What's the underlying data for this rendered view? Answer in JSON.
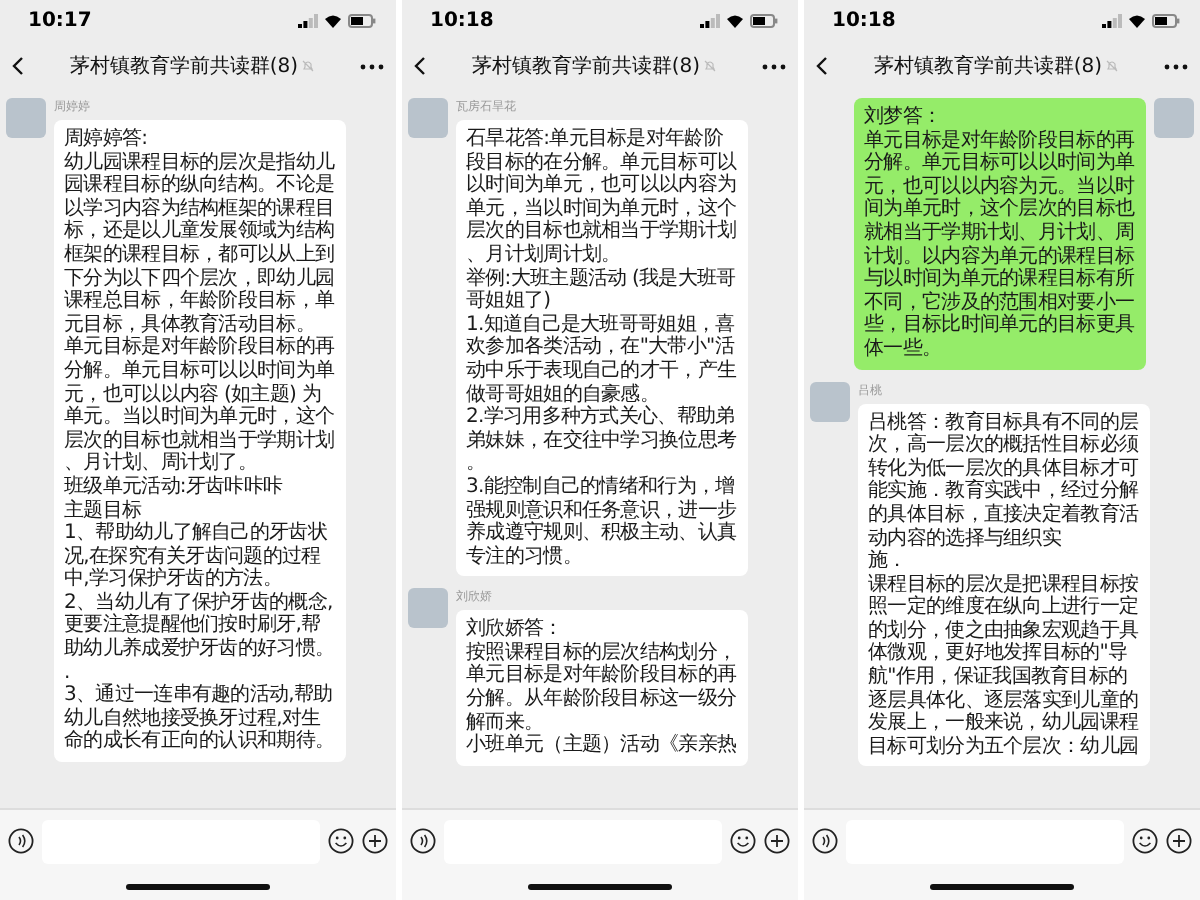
{
  "phones": [
    {
      "time": "10:17",
      "title": "茅村镇教育学前共读群(8)",
      "messages": [
        {
          "kind": "received",
          "sender": "周婷婷",
          "paragraphs": [
            "周婷婷答:",
            "幼儿园课程目标的层次是指幼儿园课程目标的纵向结构。不论是以学习内容为结构框架的课程目标，还是以儿童发展领域为结构框架的课程目标，都可以从上到下分为以下四个层次，即幼儿园课程总目标，年龄阶段目标，单元目标，具体教育活动目标。",
            "单元目标是对年龄阶段目标的再分解。单元目标可以以时间为单元，也可以以内容 (如主题) 为单元。当以时间为单元时，这个层次的目标也就相当于学期计划、月计划、周计划了。",
            "班级单元活动:牙齿咔咔咔",
            "主题目标",
            "1、帮助幼儿了解自己的牙齿状况,在探究有关牙齿问题的过程中,学习保护牙齿的方法。",
            "2、当幼儿有了保护牙齿的概念,更要注意提醒他们按时刷牙,帮助幼儿养成爱护牙齿的好习惯。.",
            "3、通过一连串有趣的活动,帮助幼儿自然地接受换牙过程,对生命的成长有正向的认识和期待。"
          ]
        }
      ]
    },
    {
      "time": "10:18",
      "title": "茅村镇教育学前共读群(8)",
      "messages": [
        {
          "kind": "received",
          "sender": "瓦房石旱花",
          "paragraphs": [
            "石旱花答:单元目标是对年龄阶段目标的在分解。单元目标可以以时间为单元，也可以以内容为单元，当以时间为单元时，这个层次的目标也就相当于学期计划、月计划周计划。",
            "举例:大班主题活动 (我是大班哥哥姐姐了)",
            "1.知道自己是大班哥哥姐姐，喜欢参加各类活动，在\"大带小\"活动中乐于表现自己的才干，产生做哥哥姐姐的自豪感。",
            "2.学习用多种方式关心、帮助弟弟妹妹，在交往中学习换位思考。",
            "3.能控制自己的情绪和行为，增强规则意识和任务意识，进一步养成遵守规则、积极主动、认真专注的习惯。"
          ]
        },
        {
          "kind": "received",
          "sender": "刘欣娇",
          "paragraphs": [
            "刘欣娇答：",
            "按照课程目标的层次结构划分，单元目标是对年龄阶段目标的再分解。从年龄阶段目标这一级分解而来。",
            "小班单元（主题）活动《亲亲热"
          ]
        }
      ]
    },
    {
      "time": "10:18",
      "title": "茅村镇教育学前共读群(8)",
      "messages": [
        {
          "kind": "sent",
          "paragraphs": [
            "刘梦答：",
            "单元目标是对年龄阶段目标的再分解。单元目标可以以时间为单元，也可以以内容为元。当以时间为单元时，这个层次的目标也就相当于学期计划、月计划、周计划。以内容为单元的课程目标与以时间为单元的课程目标有所不同，它涉及的范围相对要小一些，目标比时间单元的目标更具体一些。"
          ]
        },
        {
          "kind": "received",
          "sender": "吕桃",
          "paragraphs": [
            "吕桃答：教育目标具有不同的层次，高一层次的概括性目标必须转化为低一层次的具体目标才可能实施．教育实践中，经过分解的具体目标，直接决定着教育活动内容的选择与组织实",
            "施．",
            "课程目标的层次是把课程目标按照一定的维度在纵向上进行一定的划分，使之由抽象宏观趋于具体微观，更好地发挥目标的\"导航\"作用，保证我国教育目标的逐层具体化、逐层落实到儿童的发展上，一般来说，幼儿园课程目标可划分为五个层次：幼儿园"
          ]
        }
      ]
    }
  ]
}
